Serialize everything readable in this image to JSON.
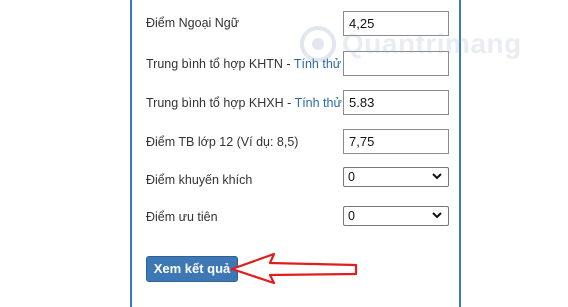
{
  "form": {
    "foreign_language": {
      "label": "Điểm Ngoại Ngữ",
      "value": "4,25"
    },
    "khtn": {
      "label": "Trung bình tổ hợp KHTN - ",
      "link": "Tính thử",
      "value": ""
    },
    "khxh": {
      "label": "Trung bình tổ hợp KHXH - ",
      "link": "Tính thử",
      "value": "5.83"
    },
    "grade12": {
      "label": "Điểm TB lớp 12 (Ví dụ: 8,5)",
      "value": "7,75"
    },
    "encouragement": {
      "label": "Điểm khuyến khích",
      "selected": "0"
    },
    "priority": {
      "label": "Điểm ưu tiên",
      "selected": "0"
    },
    "submit_label": "Xem kết quả"
  },
  "watermark": {
    "text": "Quantrimang"
  },
  "colors": {
    "accent": "#3d78b5",
    "arrow": "#e01e1e",
    "border": "#3a79b8",
    "link": "#2a6aa6"
  }
}
